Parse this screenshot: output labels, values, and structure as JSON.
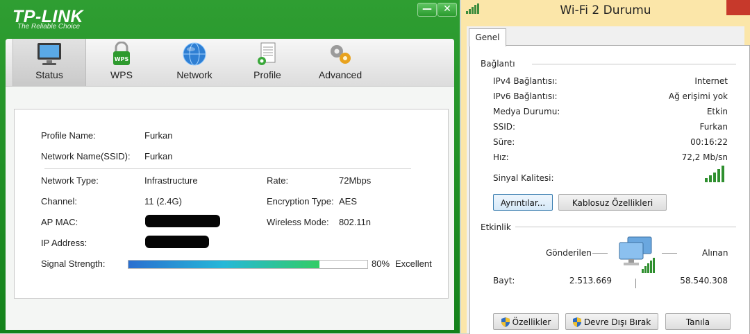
{
  "tplink": {
    "brand": "TP-LINK",
    "tagline": "The Reliable Choice",
    "window_controls": {
      "minimize": "—",
      "close": "✕"
    },
    "toolbar": [
      {
        "label": "Status",
        "icon": "monitor-icon",
        "active": true
      },
      {
        "label": "WPS",
        "icon": "wps-lock-icon",
        "active": false
      },
      {
        "label": "Network",
        "icon": "globe-icon",
        "active": false
      },
      {
        "label": "Profile",
        "icon": "profile-doc-icon",
        "active": false
      },
      {
        "label": "Advanced",
        "icon": "gears-icon",
        "active": false
      }
    ],
    "status": {
      "profile_name_label": "Profile Name:",
      "profile_name": "Furkan",
      "ssid_label": "Network Name(SSID):",
      "ssid": "Furkan",
      "network_type_label": "Network Type:",
      "network_type": "Infrastructure",
      "rate_label": "Rate:",
      "rate": "72Mbps",
      "channel_label": "Channel:",
      "channel": "11 (2.4G)",
      "encryption_label": "Encryption Type:",
      "encryption": "AES",
      "ap_mac_label": "AP MAC:",
      "wireless_mode_label": "Wireless Mode:",
      "wireless_mode": "802.11n",
      "ip_label": "IP Address:",
      "signal_label": "Signal Strength:",
      "signal_percent": "80%",
      "signal_fraction": 0.8,
      "signal_quality": "Excellent"
    }
  },
  "dialog": {
    "title": "Wi-Fi 2 Durumu",
    "tab": "Genel",
    "connection_header": "Bağlantı",
    "rows": [
      {
        "label": "IPv4 Bağlantısı:",
        "value": "Internet"
      },
      {
        "label": "IPv6 Bağlantısı:",
        "value": "Ağ erişimi yok"
      },
      {
        "label": "Medya Durumu:",
        "value": "Etkin"
      },
      {
        "label": "SSID:",
        "value": "Furkan"
      },
      {
        "label": "Süre:",
        "value": "00:16:22"
      },
      {
        "label": "Hız:",
        "value": "72,2 Mb/sn"
      }
    ],
    "signal_label": "Sinyal Kalitesi:",
    "signal_bars": 5,
    "details_button": "Ayrıntılar...",
    "wireless_props_button": "Kablosuz Özellikleri",
    "activity_header": "Etkinlik",
    "sent_label": "Gönderilen",
    "received_label": "Alınan",
    "bytes_label": "Bayt:",
    "bytes_sent": "2.513.669",
    "bytes_received": "58.540.308",
    "properties_button": "Özellikler",
    "disable_button": "Devre Dışı Bırak",
    "close_button": "Tanıla"
  }
}
